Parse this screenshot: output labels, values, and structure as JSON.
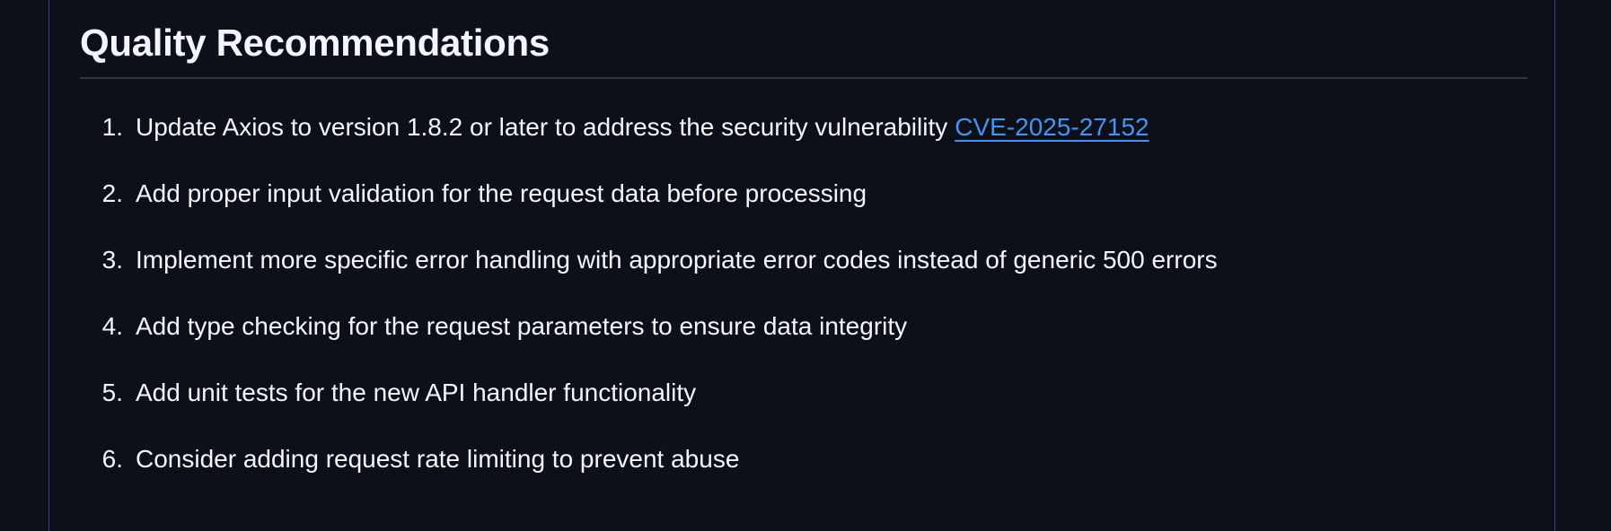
{
  "section": {
    "title": "Quality Recommendations"
  },
  "recommendations": [
    {
      "number": "1.",
      "text": "Update Axios to version 1.8.2 or later to address the security vulnerability",
      "link": "CVE-2025-27152"
    },
    {
      "number": "2.",
      "text": "Add proper input validation for the request data before processing"
    },
    {
      "number": "3.",
      "text": "Implement more specific error handling with appropriate error codes instead of generic 500 errors"
    },
    {
      "number": "4.",
      "text": "Add type checking for the request parameters to ensure data integrity"
    },
    {
      "number": "5.",
      "text": "Add unit tests for the new API handler functionality"
    },
    {
      "number": "6.",
      "text": "Consider adding request rate limiting to prevent abuse"
    }
  ],
  "colors": {
    "background": "#0d1117",
    "text": "#f0f6fc",
    "link": "#4493f8",
    "divider": "#30363d",
    "panel_border": "#2b4a85"
  }
}
